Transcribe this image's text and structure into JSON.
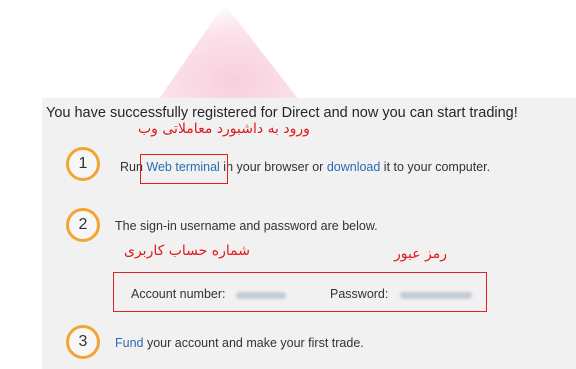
{
  "heading": "You have successfully registered for Direct and now you can start trading!",
  "annotations": {
    "dashboard": "ورود به داشبورد معاملاتی وب",
    "account_number": "شماره حساب کاربری",
    "password": "رمز عبور",
    "color": "#e02020"
  },
  "steps": [
    {
      "number": "1",
      "pre": "Run ",
      "link1": "Web terminal",
      "mid": " in your browser or ",
      "link2": "download",
      "post": " it to your computer."
    },
    {
      "number": "2",
      "text": "The sign-in username and password are below."
    },
    {
      "number": "3",
      "link": "Fund",
      "post": " your account and make your first trade."
    }
  ],
  "credentials": {
    "account_label": "Account number:",
    "password_label": "Password:"
  },
  "colors": {
    "step_ring": "#f3a533",
    "link": "#2a6bb2",
    "panel_bg": "#f1f1f1"
  }
}
